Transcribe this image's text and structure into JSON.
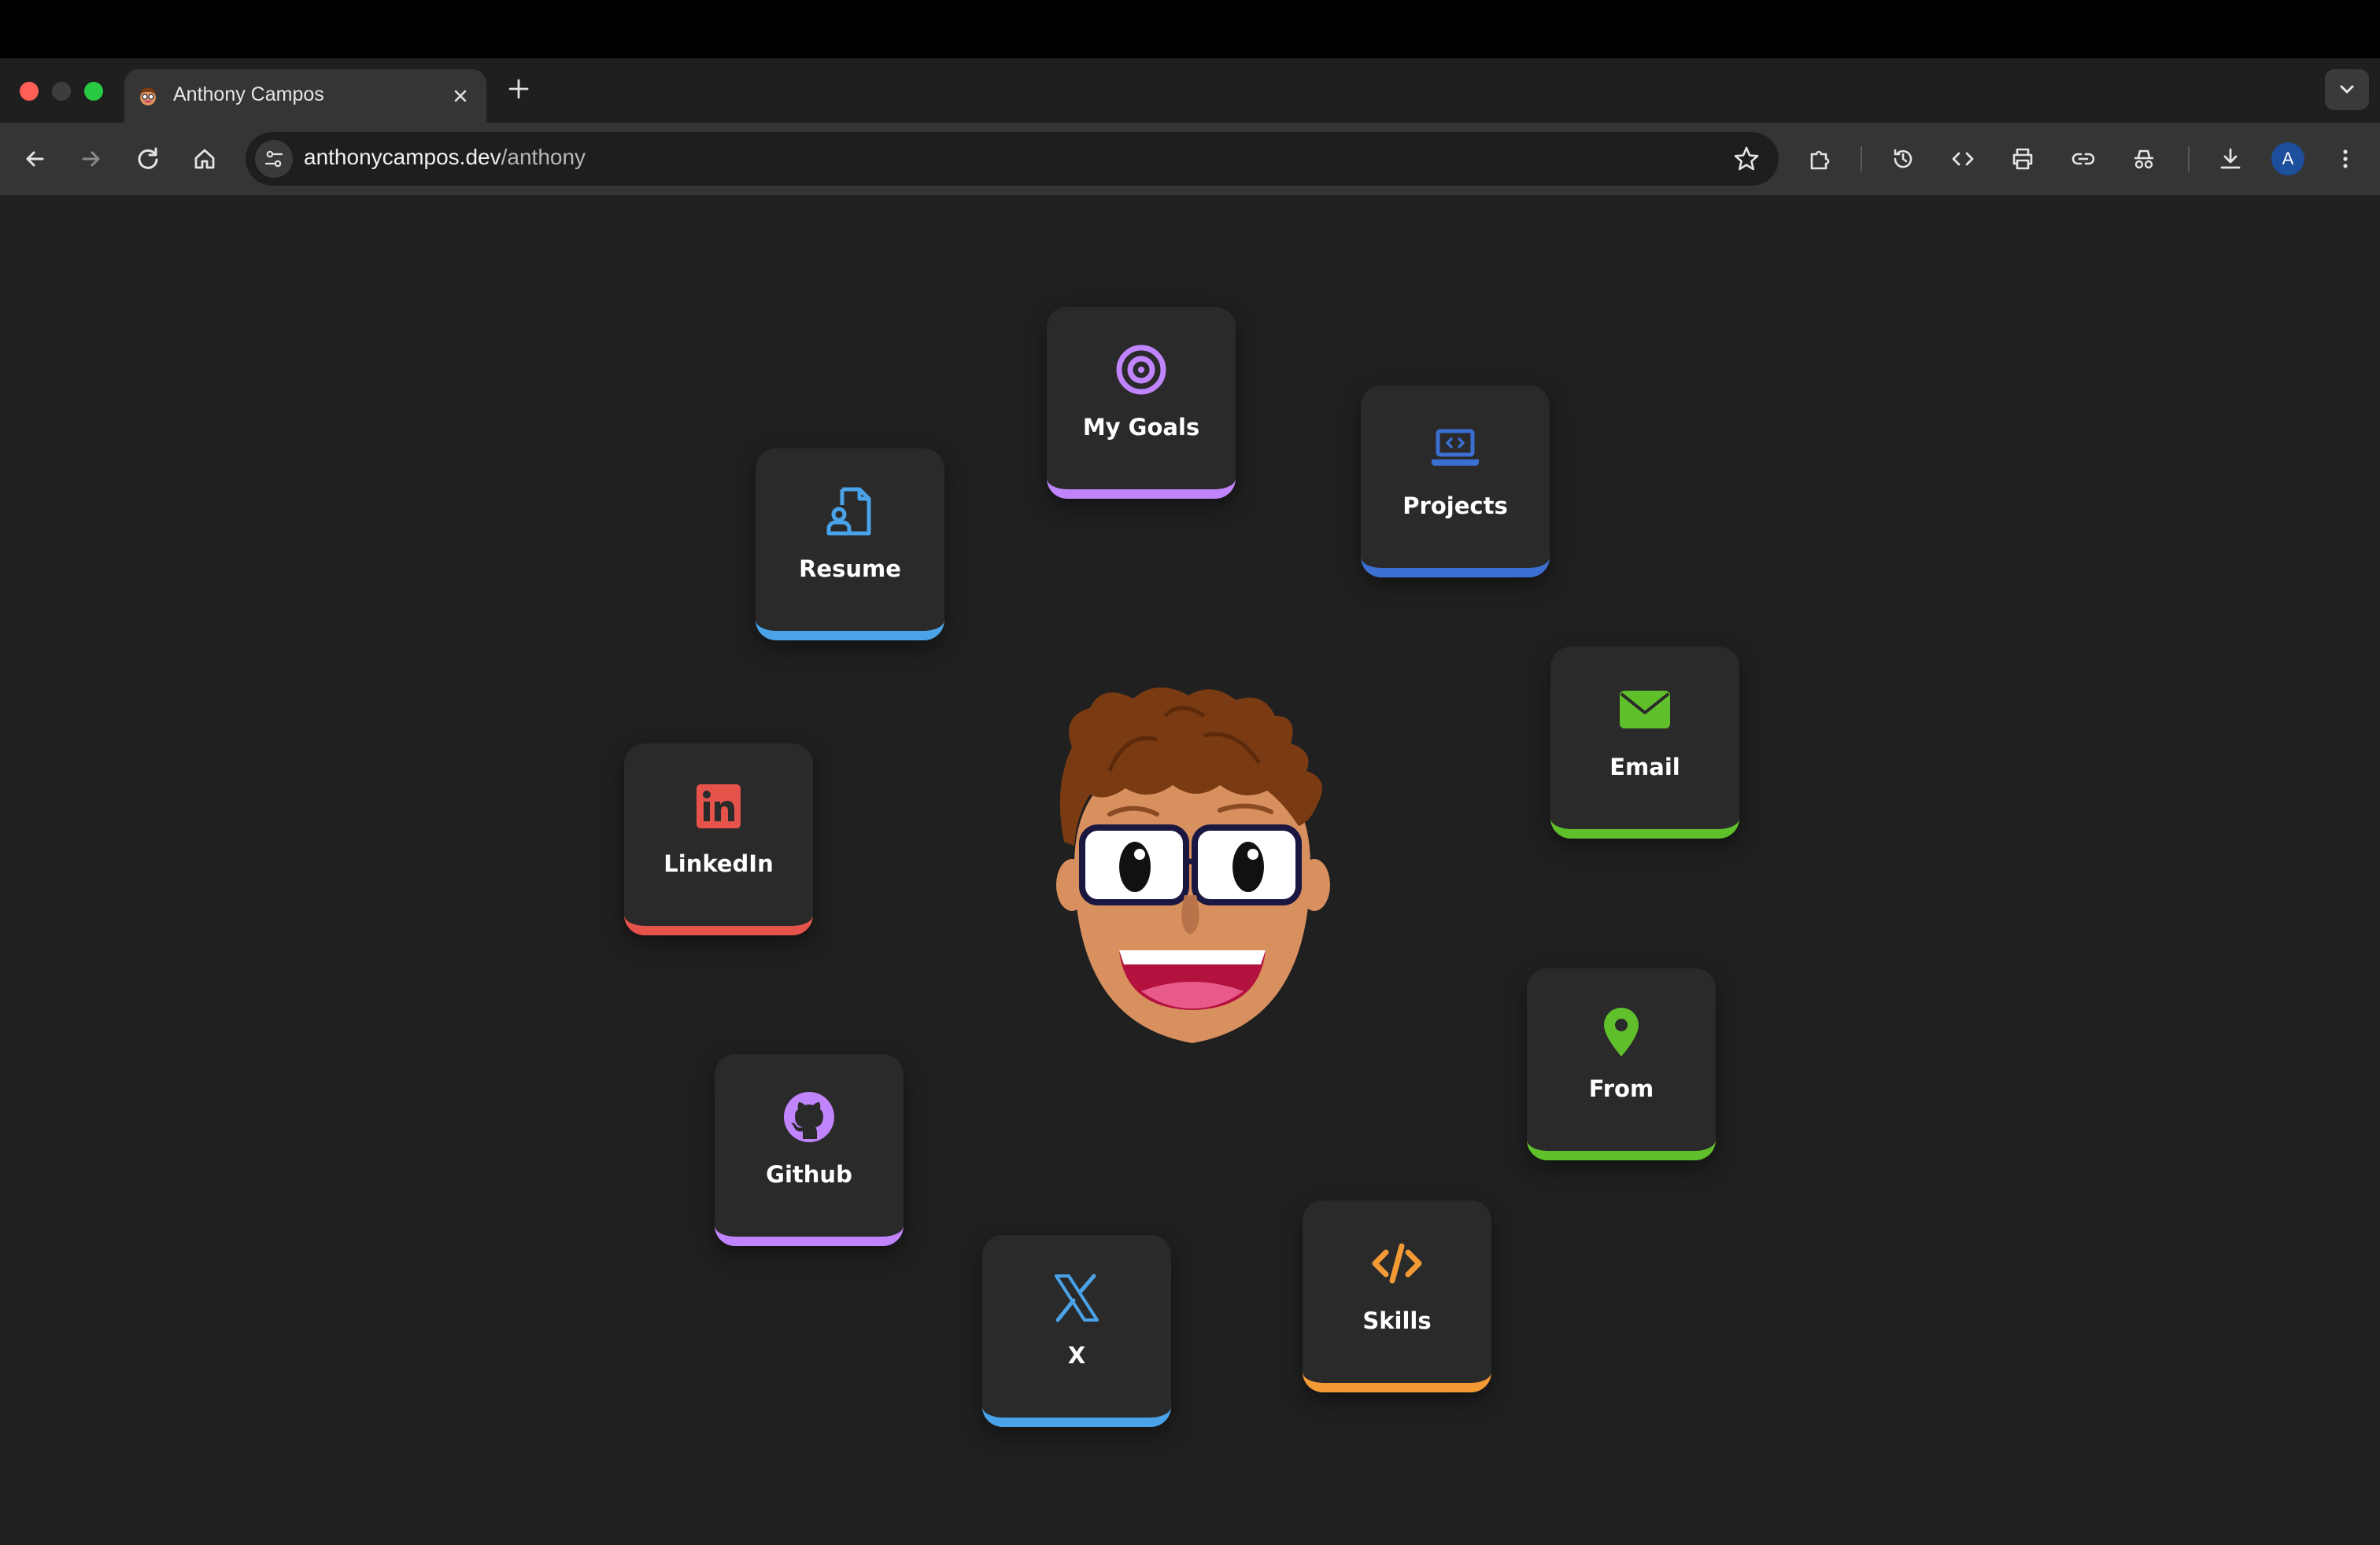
{
  "browser": {
    "tab": {
      "title": "Anthony Campos"
    },
    "url": {
      "host": "anthonycampos.dev",
      "path": "/anthony"
    },
    "profile_initial": "A"
  },
  "page": {
    "cards": [
      {
        "id": "goals",
        "label": "My Goals",
        "icon": "target-icon",
        "accent": "#c084fc"
      },
      {
        "id": "projects",
        "label": "Projects",
        "icon": "laptop-code-icon",
        "accent": "#3b6fd1"
      },
      {
        "id": "resume",
        "label": "Resume",
        "icon": "document-user-icon",
        "accent": "#4aa3e8"
      },
      {
        "id": "email",
        "label": "Email",
        "icon": "envelope-icon",
        "accent": "#5fc02c"
      },
      {
        "id": "linkedin",
        "label": "LinkedIn",
        "icon": "linkedin-icon",
        "accent": "#e5534b"
      },
      {
        "id": "from",
        "label": "From",
        "icon": "map-pin-icon",
        "accent": "#5fc02c"
      },
      {
        "id": "github",
        "label": "Github",
        "icon": "github-icon",
        "accent": "#c084fc"
      },
      {
        "id": "skills",
        "label": "Skills",
        "icon": "code-icon",
        "accent": "#f39a35"
      },
      {
        "id": "x",
        "label": "X",
        "icon": "x-logo-icon",
        "accent": "#4aa3e8"
      }
    ]
  },
  "colors": {
    "background": "#202020",
    "card": "#2a2a2b"
  }
}
